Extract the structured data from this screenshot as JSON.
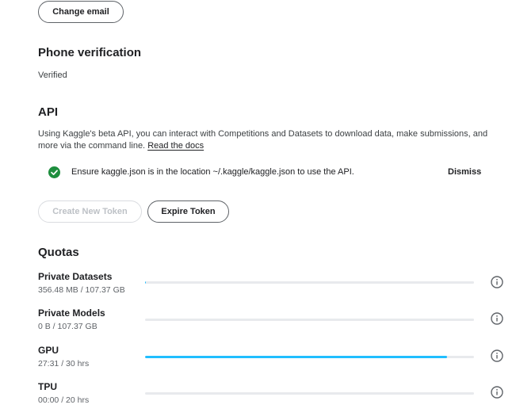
{
  "account": {
    "change_email_label": "Change email"
  },
  "phone": {
    "title": "Phone verification",
    "status": "Verified"
  },
  "api": {
    "title": "API",
    "description": "Using Kaggle's beta API, you can interact with Competitions and Datasets to download data, make submissions, and more via the command line.",
    "docs_link": "Read the docs",
    "notice_text": "Ensure kaggle.json is in the location ~/.kaggle/kaggle.json to use the API.",
    "notice_icon": "check-circle-icon",
    "dismiss_label": "Dismiss",
    "create_token_label": "Create New Token",
    "expire_token_label": "Expire Token"
  },
  "quotas": {
    "title": "Quotas",
    "accent_color": "#20beff",
    "items": [
      {
        "name": "Private Datasets",
        "usage": "356.48 MB / 107.37 GB",
        "fraction": 0.003,
        "icon": "info-icon"
      },
      {
        "name": "Private Models",
        "usage": "0 B / 107.37 GB",
        "fraction": 0.0,
        "icon": "info-icon"
      },
      {
        "name": "GPU",
        "usage": "27:31 / 30 hrs",
        "fraction": 0.917,
        "icon": "info-icon"
      },
      {
        "name": "TPU",
        "usage": "00:00 / 20 hrs",
        "fraction": 0.0,
        "icon": "info-icon"
      }
    ]
  }
}
